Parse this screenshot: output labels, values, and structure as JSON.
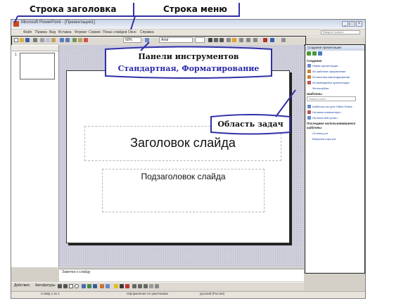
{
  "annotations": {
    "title_bar": "Строка заголовка",
    "menu_bar": "Строка меню",
    "toolbars_line1": "Панели инструментов",
    "toolbars_line2": "Стандартная, Форматирование",
    "task_pane": "Область задач"
  },
  "window": {
    "title": "Microsoft PowerPoint - [Презентация1]",
    "controls": [
      "_",
      "□",
      "×"
    ]
  },
  "menu": {
    "items": [
      "Файл",
      "Правка",
      "Вид",
      "Вставка",
      "Формат",
      "Сервис",
      "Показ слайдов",
      "Окно",
      "Справка"
    ],
    "help_placeholder": "Введите вопрос"
  },
  "toolbar": {
    "zoom": "60%",
    "font": "Arial",
    "icons": [
      "new-icon",
      "open-icon",
      "save-icon",
      "print-icon",
      "cut-icon",
      "copy-icon",
      "paste-icon",
      "undo-icon",
      "redo-icon",
      "bold-icon",
      "italic-icon",
      "underline-icon",
      "align-icon"
    ]
  },
  "thumbnails": {
    "slide_number": "1"
  },
  "slide": {
    "title": "Заголовок слайда",
    "subtitle": "Подзаголовок слайда"
  },
  "task_pane": {
    "header": "Создание презентации",
    "create_heading": "Создание",
    "create_links": [
      "Новая презентация",
      "Из шаблона оформления",
      "Из мастера автосодержания",
      "Из имеющейся презентации",
      "Фотоальбом"
    ],
    "templates_heading": "Шаблоны",
    "search_placeholder": "Поиск в сети:",
    "template_links": [
      "Шаблоны на узле Office Online",
      "На моем компьютере...",
      "На моих веб-узлах..."
    ],
    "recent_heading": "Последние использовавшиеся шаблоны",
    "recent_links": [
      "Оттенок.pot",
      "Вершина горы.pot"
    ]
  },
  "notes": {
    "placeholder": "Заметки к слайду"
  },
  "drawing_toolbar": {
    "actions_label": "Действия",
    "autoshapes_label": "Автофигуры"
  },
  "status": {
    "slide": "Слайд 1 из 1",
    "design": "Оформление по умолчанию",
    "language": "русский (Россия)"
  }
}
